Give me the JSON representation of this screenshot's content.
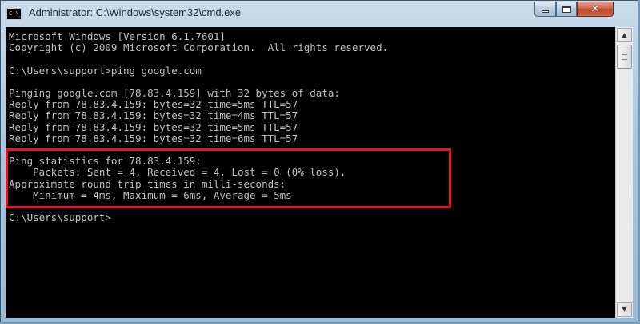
{
  "window": {
    "title": "Administrator: C:\\Windows\\system32\\cmd.exe",
    "app_icon_text": "C:\\_",
    "controls": {
      "minimize": "minimize",
      "maximize": "maximize",
      "close": "✕"
    }
  },
  "console": {
    "lines": [
      "Microsoft Windows [Version 6.1.7601]",
      "Copyright (c) 2009 Microsoft Corporation.  All rights reserved.",
      "",
      "C:\\Users\\support>ping google.com",
      "",
      "Pinging google.com [78.83.4.159] with 32 bytes of data:",
      "Reply from 78.83.4.159: bytes=32 time=5ms TTL=57",
      "Reply from 78.83.4.159: bytes=32 time=4ms TTL=57",
      "Reply from 78.83.4.159: bytes=32 time=5ms TTL=57",
      "Reply from 78.83.4.159: bytes=32 time=6ms TTL=57",
      "",
      "Ping statistics for 78.83.4.159:",
      "    Packets: Sent = 4, Received = 4, Lost = 0 (0% loss),",
      "Approximate round trip times in milli-seconds:",
      "    Minimum = 4ms, Maximum = 6ms, Average = 5ms",
      "",
      "C:\\Users\\support>"
    ],
    "colors": {
      "background": "#000000",
      "text": "#c0c0c0",
      "highlight": "#e8141b"
    }
  },
  "scrollbar": {
    "up_arrow": "▲",
    "down_arrow": "▼"
  }
}
